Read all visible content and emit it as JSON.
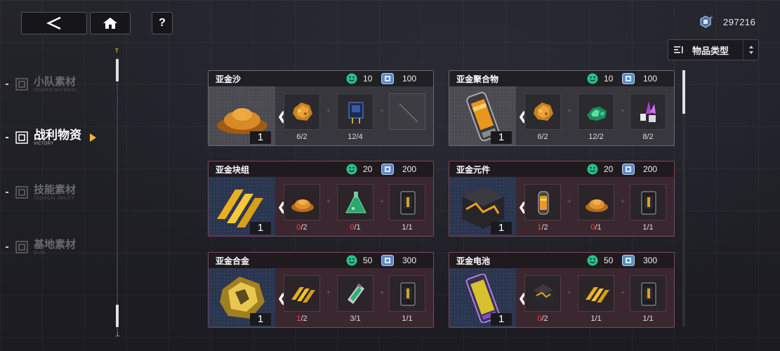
{
  "header": {
    "currency_value": "297216",
    "filter_label": "物品类型",
    "help_label": "?"
  },
  "sidebar": {
    "items": [
      {
        "main": "小队素材",
        "sub": "SOURCE MATERIAL",
        "active": false
      },
      {
        "main": "战利物资",
        "sub": "VICTORY",
        "active": true
      },
      {
        "main": "技能素材",
        "sub": "TECHICAL ABILITY",
        "active": false
      },
      {
        "main": "基地素材",
        "sub": "BASE",
        "active": false
      }
    ]
  },
  "colors": {
    "accent": "#f5b82a",
    "insufficient": "#ff4040",
    "smile_green": "#28c28a",
    "chip_blue": "#5a8ac8"
  },
  "cards": [
    {
      "name": "亚金沙",
      "cost_a": "10",
      "cost_b": "100",
      "count": "1",
      "theme": "grey",
      "materials": [
        {
          "icon": "gold-ore-icon",
          "have": "6",
          "need": "2",
          "short": false
        },
        {
          "icon": "microchip-icon",
          "have": "12",
          "need": "4",
          "short": false
        },
        {
          "icon": "empty-slot-icon",
          "have": "",
          "need": "",
          "short": false
        }
      ]
    },
    {
      "name": "亚金聚合物",
      "cost_a": "10",
      "cost_b": "100",
      "count": "1",
      "theme": "grey",
      "materials": [
        {
          "icon": "gold-ore-icon",
          "have": "6",
          "need": "2",
          "short": false
        },
        {
          "icon": "green-crystal-icon",
          "have": "12",
          "need": "2",
          "short": false
        },
        {
          "icon": "purple-crystal-icon",
          "have": "8",
          "need": "2",
          "short": false
        }
      ]
    },
    {
      "name": "亚金块组",
      "cost_a": "20",
      "cost_b": "200",
      "count": "1",
      "theme": "red",
      "materials": [
        {
          "icon": "gold-sand-icon",
          "have": "0",
          "need": "2",
          "short": true
        },
        {
          "icon": "green-flask-icon",
          "have": "0",
          "need": "1",
          "short": true
        },
        {
          "icon": "dark-cell-icon",
          "have": "1",
          "need": "1",
          "short": false
        }
      ]
    },
    {
      "name": "亚金元件",
      "cost_a": "20",
      "cost_b": "200",
      "count": "1",
      "theme": "red",
      "materials": [
        {
          "icon": "gold-capsule-icon",
          "have": "1",
          "need": "2",
          "short": true
        },
        {
          "icon": "gold-sand-icon",
          "have": "0",
          "need": "1",
          "short": true
        },
        {
          "icon": "dark-cell-icon",
          "have": "1",
          "need": "1",
          "short": false
        }
      ]
    },
    {
      "name": "亚金合金",
      "cost_a": "50",
      "cost_b": "300",
      "count": "1",
      "theme": "red",
      "materials": [
        {
          "icon": "gold-bars-icon",
          "have": "1",
          "need": "2",
          "short": true
        },
        {
          "icon": "green-canister-icon",
          "have": "3",
          "need": "1",
          "short": false
        },
        {
          "icon": "dark-cell-icon",
          "have": "1",
          "need": "1",
          "short": false
        }
      ]
    },
    {
      "name": "亚金电池",
      "cost_a": "50",
      "cost_b": "300",
      "count": "1",
      "theme": "red",
      "materials": [
        {
          "icon": "dark-cube-icon",
          "have": "0",
          "need": "2",
          "short": true
        },
        {
          "icon": "gold-bars-icon",
          "have": "1",
          "need": "1",
          "short": false
        },
        {
          "icon": "dark-cell-icon",
          "have": "1",
          "need": "1",
          "short": false
        }
      ]
    }
  ]
}
